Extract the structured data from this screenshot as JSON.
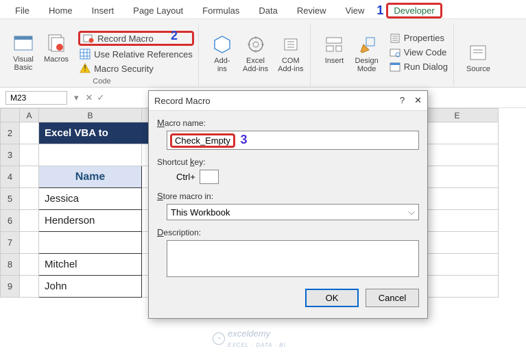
{
  "tabs": [
    "File",
    "Home",
    "Insert",
    "Page Layout",
    "Formulas",
    "Data",
    "Review",
    "View",
    "Developer"
  ],
  "annotations": {
    "n1": "1",
    "n2": "2",
    "n3": "3"
  },
  "ribbon": {
    "code": {
      "visual_basic": "Visual\nBasic",
      "macros": "Macros",
      "record_macro": "Record Macro",
      "use_relative": "Use Relative References",
      "macro_security": "Macro Security",
      "title": "Code"
    },
    "addins": {
      "addins": "Add-\nins",
      "excel_addins": "Excel\nAdd-ins",
      "com_addins": "COM\nAdd-ins"
    },
    "controls": {
      "insert": "Insert",
      "design_mode": "Design\nMode",
      "properties": "Properties",
      "view_code": "View Code",
      "run_dialog": "Run Dialog"
    },
    "source": "Source"
  },
  "namebox": "M23",
  "sheet": {
    "cols": [
      "A",
      "B",
      "E"
    ],
    "rows": [
      "2",
      "3",
      "4",
      "5",
      "6",
      "7",
      "8",
      "9"
    ],
    "title": "Excel VBA to",
    "header": "Name",
    "names": [
      "Jessica",
      "Henderson",
      "",
      "Mitchel",
      "John"
    ]
  },
  "dialog": {
    "title": "Record Macro",
    "help": "?",
    "close": "✕",
    "macro_name_lbl": "Macro name:",
    "macro_name": "Check_Empty",
    "shortcut_lbl": "Shortcut key:",
    "ctrl": "Ctrl+",
    "store_lbl": "Store macro in:",
    "store_val": "This Workbook",
    "desc_lbl": "Description:",
    "ok": "OK",
    "cancel": "Cancel"
  },
  "watermark": {
    "brand": "exceldemy",
    "tag": "EXCEL · DATA · BI"
  }
}
